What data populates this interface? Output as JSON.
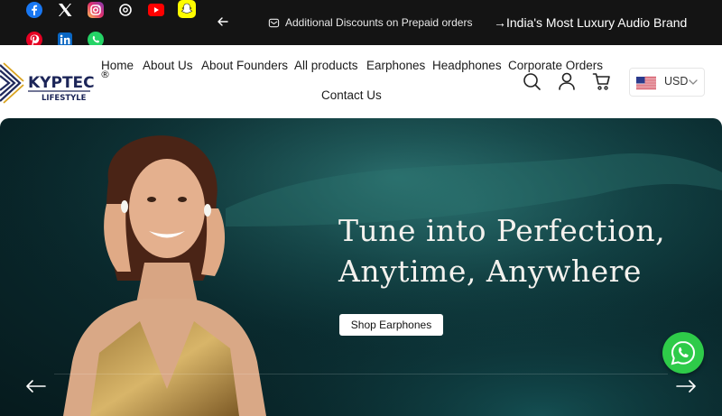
{
  "topbar": {
    "socials": [
      {
        "name": "facebook",
        "color": "#1877f2"
      },
      {
        "name": "x-twitter",
        "color": "#141414"
      },
      {
        "name": "instagram",
        "color": "#c13584"
      },
      {
        "name": "threads",
        "color": "#141414"
      },
      {
        "name": "youtube",
        "color": "#ff0000"
      },
      {
        "name": "snapchat",
        "color": "#fffc00"
      },
      {
        "name": "pinterest",
        "color": "#e60023"
      },
      {
        "name": "linkedin",
        "color": "#0a66c2"
      },
      {
        "name": "whatsapp",
        "color": "#25d366"
      }
    ],
    "announcement": "Additional Discounts on Prepaid orders",
    "tagline": "→India's Most Luxury Audio Brand"
  },
  "header": {
    "logo": {
      "brand": "KYPTEC",
      "sub": "LIFESTYLE",
      "mark": "®"
    },
    "nav": [
      "Home",
      "About Us",
      "About Founders",
      "All products",
      "Earphones",
      "Headphones",
      "Corporate Orders",
      "Contact Us"
    ],
    "currency": "USD"
  },
  "hero": {
    "line1": "Tune into Perfection,",
    "line2": "Anytime, Anywhere",
    "button": "Shop Earphones"
  },
  "colors": {
    "topbar_bg": "#141414",
    "hero_bg": "#0a2a2e",
    "whatsapp": "#2ecb49"
  }
}
